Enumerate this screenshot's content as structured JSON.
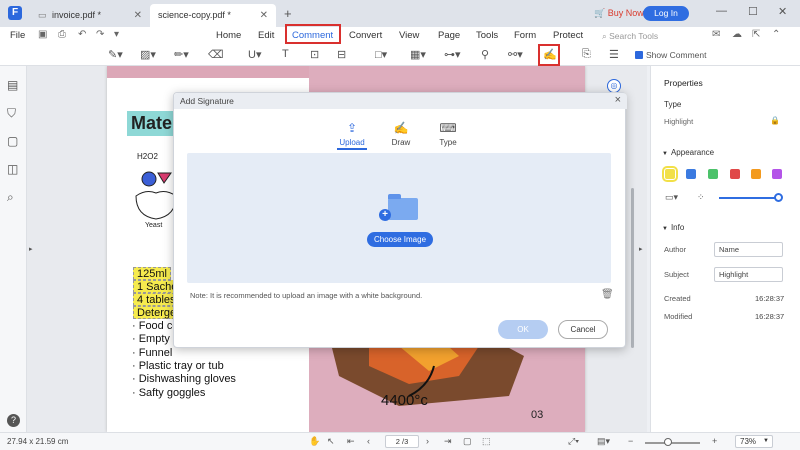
{
  "titlebar": {
    "logo": "F",
    "tabs": [
      {
        "label": "invoice.pdf *",
        "active": false
      },
      {
        "label": "science-copy.pdf *",
        "active": true
      }
    ],
    "new_tab": "+",
    "buy_now": "Buy Now",
    "login": "Log In",
    "window_controls": {
      "minimize": "—",
      "maximize": "☐",
      "close": "✕"
    }
  },
  "menubar": {
    "file": "File",
    "items": [
      "Home",
      "Edit",
      "Comment",
      "Convert",
      "View",
      "Page",
      "Tools",
      "Form",
      "Protect"
    ],
    "active": "Comment",
    "search_placeholder": "Search Tools"
  },
  "toolbar": {
    "show_comment": "Show Comment"
  },
  "document": {
    "heading": "Mate",
    "h2o2": "H2O2",
    "yeast": "Yeast",
    "highlighted_items": [
      "125ml",
      "1 Sache",
      "4 tables",
      "Deterge"
    ],
    "list_items": [
      "· Food co",
      "· Empty b",
      "· Funnel",
      "· Plastic tray or tub",
      "· Dishwashing gloves",
      "· Safty goggles"
    ],
    "temperature_note": "4400°c",
    "page_number": "03"
  },
  "dialog": {
    "title": "Add Signature",
    "close": "×",
    "tabs": [
      {
        "label": "Upload",
        "active": true
      },
      {
        "label": "Draw",
        "active": false
      },
      {
        "label": "Type",
        "active": false
      }
    ],
    "choose_image": "Choose Image",
    "note": "Note: It is recommended to upload an image with a white background.",
    "ok": "OK",
    "cancel": "Cancel"
  },
  "properties": {
    "title": "Properties",
    "type_label": "Type",
    "type_value": "Highlight",
    "appearance_label": "Appearance",
    "colors": [
      "#f2e048",
      "#3b7ae0",
      "#4cc26a",
      "#e04848",
      "#f39a1e",
      "#b454e8"
    ],
    "selected_color": "#f2e048",
    "opacity_percent": 95,
    "info_label": "Info",
    "author_label": "Author",
    "author_value": "Name",
    "subject_label": "Subject",
    "subject_value": "Highlight",
    "created_label": "Created",
    "created_value": "16:28:37",
    "modified_label": "Modified",
    "modified_value": "16:28:37"
  },
  "statusbar": {
    "dimensions": "27.94 x 21.59 cm",
    "page_field": "2 /3",
    "zoom": "73%"
  }
}
